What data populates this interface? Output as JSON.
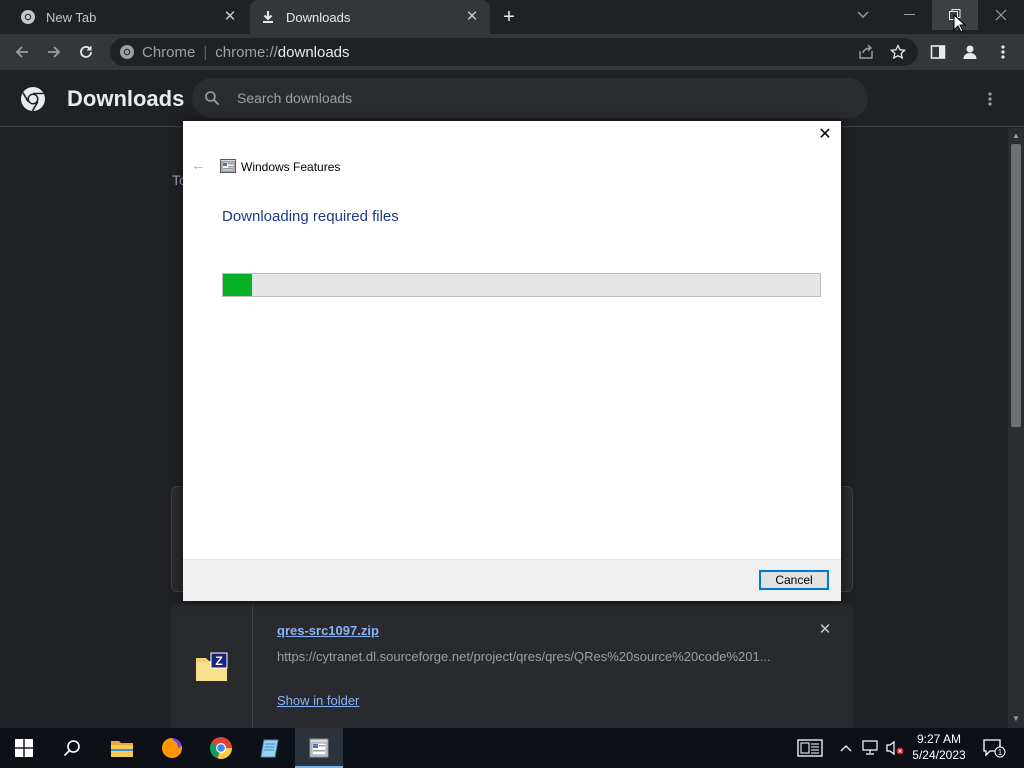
{
  "browser": {
    "tabs": [
      {
        "label": "New Tab",
        "icon": "chrome-icon",
        "active": false
      },
      {
        "label": "Downloads",
        "icon": "download-icon",
        "active": true
      }
    ],
    "new_tab_symbol": "+",
    "omnibox": {
      "scheme_label": "Chrome",
      "separator": "|",
      "url_protocol": "chrome://",
      "url_host": "downloads"
    }
  },
  "downloads_page": {
    "title": "Downloads",
    "search_placeholder": "Search downloads",
    "section_partial": "To",
    "item": {
      "filename": "qres-src1097.zip",
      "url": "https://cytranet.dl.sourceforge.net/project/qres/qres/QRes%20source%20code%201...",
      "show_in_folder": "Show in folder",
      "close_symbol": "✕"
    }
  },
  "dialog": {
    "title": "Windows Features",
    "heading": "Downloading required files",
    "progress": 0.048,
    "cancel_label": "Cancel",
    "close_symbol": "✕",
    "back_symbol": "←"
  },
  "taskbar": {
    "time": "9:27 AM",
    "date": "5/24/2023",
    "notification_count": "1"
  },
  "colors": {
    "chrome_dark_bg": "#202124",
    "toolbar_bg": "#35363a",
    "link_blue": "#8ab4f8",
    "progress_green": "#06b025",
    "dialog_heading": "#1e3a8a",
    "focus_blue": "#0078d7"
  }
}
